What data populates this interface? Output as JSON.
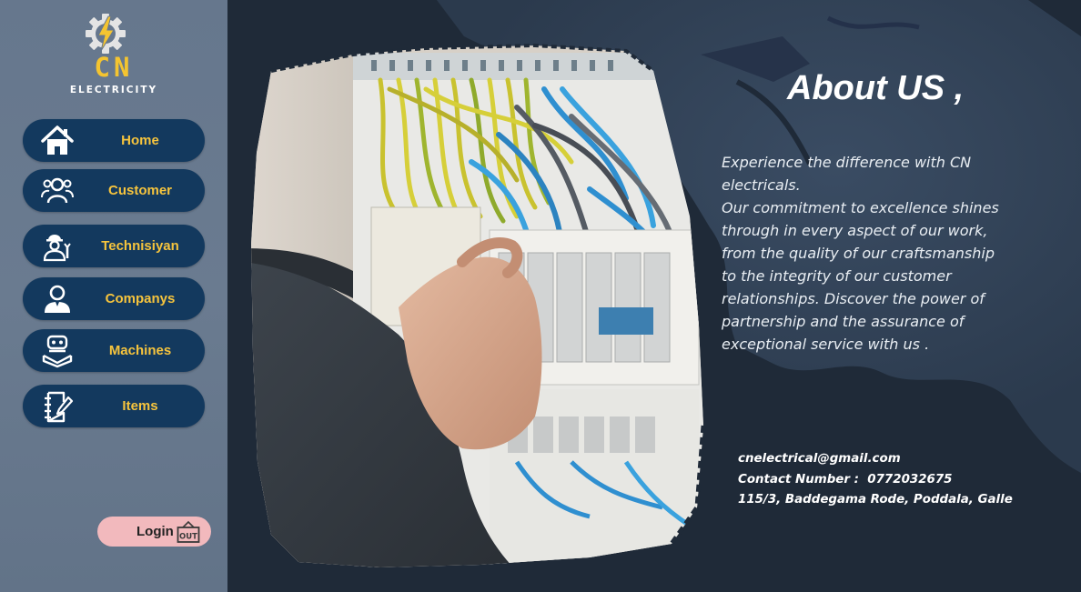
{
  "brand": {
    "logo_text": "CN",
    "logo_subtext": "ELECTRICITY",
    "logo_icon": "gear-lightning-icon",
    "accent_color": "#f4c430"
  },
  "sidebar": {
    "items": [
      {
        "label": "Home",
        "icon": "home-icon"
      },
      {
        "label": "Customer",
        "icon": "users-icon"
      },
      {
        "label": "Technisiyan",
        "icon": "technician-icon"
      },
      {
        "label": "Companys",
        "icon": "user-icon"
      },
      {
        "label": "Machines",
        "icon": "robot-icon"
      },
      {
        "label": "Items",
        "icon": "notebook-edit-icon"
      }
    ],
    "button_color": "#13395e",
    "label_color": "#f6c43d"
  },
  "login": {
    "label": "Login",
    "icon": "logout-box-icon",
    "color": "#f2b9bd"
  },
  "about": {
    "title": "About US ,",
    "text": "Experience the difference with CN electricals.\nOur commitment to excellence shines\nthrough in every aspect of our work,\nfrom the quality of our craftsmanship\nto the integrity of our customer\nrelationships. Discover the power of\npartnership and the assurance of\nexceptional service with us ."
  },
  "contact": {
    "email": "cnelectrical@gmail.com",
    "phone_line": "Contact Number :  0772032675",
    "address": "115/3, Baddegama Rode, Poddala, Galle"
  },
  "hero_image": {
    "icon": "electrician-photo"
  }
}
